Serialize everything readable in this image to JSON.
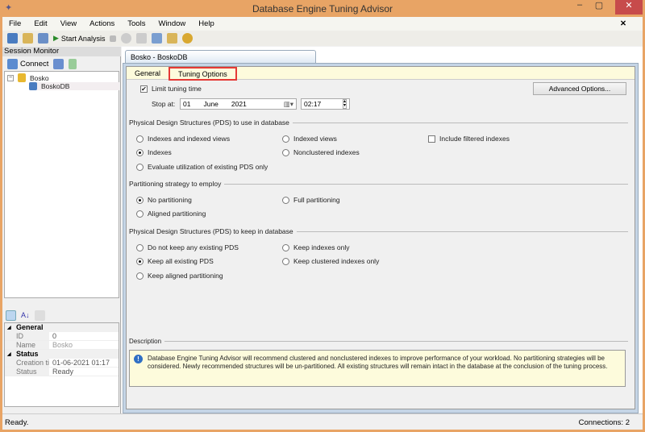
{
  "window": {
    "title": "Database Engine Tuning Advisor"
  },
  "menu": [
    "File",
    "Edit",
    "View",
    "Actions",
    "Tools",
    "Window",
    "Help"
  ],
  "toolbar": {
    "start_analysis": "Start Analysis"
  },
  "session_monitor": {
    "title": "Session Monitor",
    "connect": "Connect",
    "tree": {
      "server": "Bosko",
      "session": "BoskoDB"
    }
  },
  "properties": {
    "categories": [
      {
        "name": "General",
        "rows": [
          {
            "k": "ID",
            "v": "0"
          },
          {
            "k": "Name",
            "v": "Bosko"
          }
        ]
      },
      {
        "name": "Status",
        "rows": [
          {
            "k": "Creation time",
            "v": "01-06-2021 01:17"
          },
          {
            "k": "Status",
            "v": "Ready"
          }
        ]
      }
    ]
  },
  "doc_tab": "Bosko - BoskoDB",
  "tabs": {
    "general": "General",
    "tuning": "Tuning Options"
  },
  "tuning": {
    "limit_label": "Limit tuning time",
    "limit_checked": true,
    "stop_at_label": "Stop at:",
    "date": {
      "day": "01",
      "month": "June",
      "year": "2021"
    },
    "time": "02:17",
    "advanced": "Advanced Options...",
    "pds_use": {
      "title": "Physical Design Structures (PDS) to use in database",
      "options": [
        "Indexes and indexed views",
        "Indexed views",
        "Indexes",
        "Nonclustered indexes",
        "Evaluate utilization of existing PDS only"
      ],
      "selected": "Indexes",
      "filtered": "Include filtered indexes"
    },
    "partition": {
      "title": "Partitioning strategy to employ",
      "options": [
        "No partitioning",
        "Full partitioning",
        "Aligned partitioning"
      ],
      "selected": "No partitioning"
    },
    "pds_keep": {
      "title": "Physical Design Structures (PDS) to keep in database",
      "options": [
        "Do not keep any existing PDS",
        "Keep indexes only",
        "Keep all existing PDS",
        "Keep clustered indexes only",
        "Keep aligned partitioning"
      ],
      "selected": "Keep all existing PDS"
    },
    "description_label": "Description",
    "description": "Database Engine Tuning Advisor will recommend clustered and nonclustered indexes to improve performance of your workload. No partitioning strategies will be considered. Newly recommended structures will be un-partitioned. All existing structures will remain intact in the database at the conclusion of the tuning process."
  },
  "status": {
    "left": "Ready.",
    "right": "Connections: 2"
  }
}
